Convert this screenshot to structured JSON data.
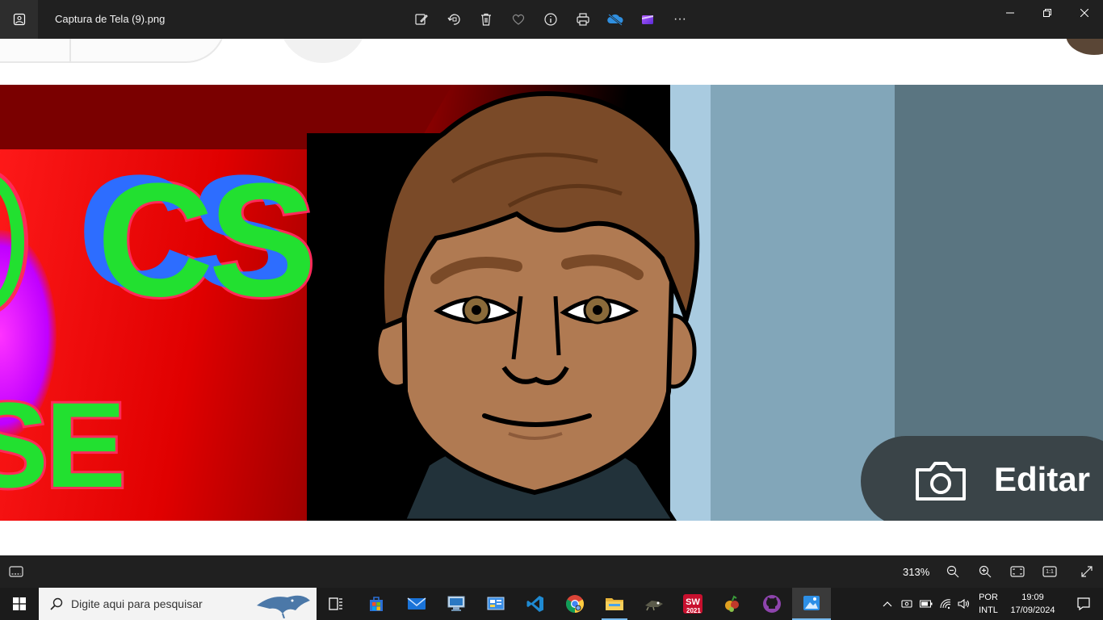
{
  "window": {
    "title": "Captura de Tela (9).png",
    "toolbar": [
      {
        "icon": "edit-image-icon"
      },
      {
        "icon": "rotate-icon"
      },
      {
        "icon": "delete-icon"
      },
      {
        "icon": "favorite-heart-icon"
      },
      {
        "icon": "info-icon"
      },
      {
        "icon": "print-icon"
      },
      {
        "icon": "onedrive-cloud-icon"
      },
      {
        "icon": "clipchamp-video-icon"
      },
      {
        "icon": "more-options-icon",
        "glyph": "···"
      }
    ],
    "controls": {
      "minimize": "—",
      "restore": "❐",
      "close": "✕"
    }
  },
  "image": {
    "banner_text_1": "CS",
    "banner_text_2": "SE",
    "edit_button_label": "Editar",
    "colors": {
      "red": "#ff1a1a",
      "green": "#22e030",
      "pink_outline": "#ff2a5a",
      "blue_shadow": "#2d6dff",
      "light_blue": "#a9cbe0",
      "mid_blue": "#82a6b9",
      "dark_blue": "#5a7581",
      "skin": "#b07a52",
      "hair": "#7a4a28"
    }
  },
  "statusbar": {
    "zoom": "313%",
    "buttons": [
      "zoom-out-icon",
      "zoom-in-icon",
      "fit-to-window-icon",
      "actual-size-icon",
      "fullscreen-icon"
    ],
    "actual_size_glyph": "1:1"
  },
  "taskbar": {
    "search_placeholder": "Digite aqui para pesquisar",
    "apps": [
      "task-view",
      "microsoft-store",
      "mail",
      "remote-desktop",
      "control-panel",
      "vscode",
      "chrome",
      "file-explorer",
      "game-app",
      "solidworks-2021",
      "fruit-app",
      "github-desktop",
      "photos"
    ],
    "solidworks_label": "2021",
    "language": {
      "line1": "POR",
      "line2": "INTL"
    },
    "time": "19:09",
    "date": "17/09/2024"
  }
}
